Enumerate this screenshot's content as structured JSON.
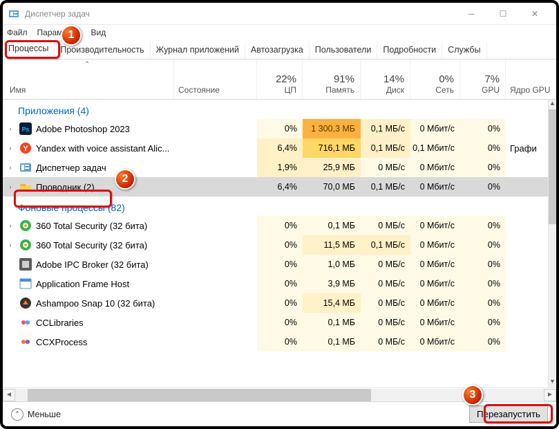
{
  "window": {
    "title": "Диспетчер задач"
  },
  "menu": {
    "file": "Файл",
    "options": "Параметры",
    "view": "Вид"
  },
  "tabs": {
    "processes": "Процессы",
    "performance": "Производительность",
    "app_history": "Журнал приложений",
    "startup": "Автозагрузка",
    "users": "Пользователи",
    "details": "Подробности",
    "services": "Службы"
  },
  "columns": {
    "name": "Имя",
    "state": "Состояние",
    "cpu": {
      "pct": "22%",
      "label": "ЦП"
    },
    "mem": {
      "pct": "91%",
      "label": "Память"
    },
    "disk": {
      "pct": "14%",
      "label": "Диск"
    },
    "net": {
      "pct": "0%",
      "label": "Сеть"
    },
    "gpu": {
      "pct": "7%",
      "label": "GPU"
    },
    "gpucore": {
      "label": "Ядро GPU"
    }
  },
  "groups": {
    "apps": "Приложения (4)",
    "bg": "Фоновые процессы (82)"
  },
  "rows": [
    {
      "group": "apps",
      "expand": true,
      "icon": "ps",
      "name": "Adobe Photoshop 2023",
      "cpu": "0%",
      "mem": "1 300,3 МБ",
      "disk": "0,1 МБ/с",
      "net": "0 Мбит/с",
      "gpu": "0%",
      "gpucore": "",
      "h": {
        "cpu": "h0",
        "mem": "h4",
        "disk": "h1",
        "net": "h0",
        "gpu": "h0"
      }
    },
    {
      "group": "apps",
      "expand": true,
      "icon": "y",
      "name": "Yandex with voice assistant Alic...",
      "cpu": "6,4%",
      "mem": "716,1 МБ",
      "disk": "0,1 МБ/с",
      "net": "0,1 Мбит/с",
      "gpu": "0%",
      "gpucore": "Графи",
      "h": {
        "cpu": "h1",
        "mem": "h3",
        "disk": "h1",
        "net": "h0",
        "gpu": "h0"
      }
    },
    {
      "group": "apps",
      "expand": true,
      "icon": "tm",
      "name": "Диспетчер задач",
      "cpu": "1,9%",
      "mem": "25,9 МБ",
      "disk": "0 МБ/с",
      "net": "0 Мбит/с",
      "gpu": "0%",
      "gpucore": "",
      "h": {
        "cpu": "h1",
        "mem": "h1",
        "disk": "h0",
        "net": "h0",
        "gpu": "h0"
      }
    },
    {
      "group": "apps",
      "expand": true,
      "icon": "folder",
      "name": "Проводник (2)",
      "cpu": "6,4%",
      "mem": "70,0 МБ",
      "disk": "0,1 МБ/с",
      "net": "0 Мбит/с",
      "gpu": "0%",
      "gpucore": "",
      "selected": true,
      "h": {
        "cpu": "hx",
        "mem": "hx",
        "disk": "hx",
        "net": "hx",
        "gpu": "hx"
      }
    },
    {
      "group": "bg",
      "expand": true,
      "icon": "360",
      "name": "360 Total Security (32 бита)",
      "cpu": "0%",
      "mem": "0,1 МБ",
      "disk": "0 МБ/с",
      "net": "0 Мбит/с",
      "gpu": "0%",
      "gpucore": "",
      "h": {
        "cpu": "h0",
        "mem": "h0",
        "disk": "h0",
        "net": "h0",
        "gpu": "h0"
      }
    },
    {
      "group": "bg",
      "expand": true,
      "icon": "360",
      "name": "360 Total Security (32 бита)",
      "cpu": "0%",
      "mem": "11,5 МБ",
      "disk": "0,1 МБ/с",
      "net": "0 Мбит/с",
      "gpu": "0%",
      "gpucore": "",
      "h": {
        "cpu": "h0",
        "mem": "h1",
        "disk": "h1",
        "net": "h0",
        "gpu": "h0"
      }
    },
    {
      "group": "bg",
      "expand": false,
      "icon": "ipc",
      "name": "Adobe IPC Broker (32 бита)",
      "cpu": "0%",
      "mem": "1,0 МБ",
      "disk": "0 МБ/с",
      "net": "0 Мбит/с",
      "gpu": "0%",
      "gpucore": "",
      "h": {
        "cpu": "h0",
        "mem": "h0",
        "disk": "h0",
        "net": "h0",
        "gpu": "h0"
      }
    },
    {
      "group": "bg",
      "expand": false,
      "icon": "afh",
      "name": "Application Frame Host",
      "cpu": "0%",
      "mem": "3,9 МБ",
      "disk": "0 МБ/с",
      "net": "0 Мбит/с",
      "gpu": "0%",
      "gpucore": "",
      "h": {
        "cpu": "h0",
        "mem": "h0",
        "disk": "h0",
        "net": "h0",
        "gpu": "h0"
      }
    },
    {
      "group": "bg",
      "expand": false,
      "icon": "ash",
      "name": "Ashampoo Snap 10 (32 бита)",
      "cpu": "0%",
      "mem": "15,4 МБ",
      "disk": "0 МБ/с",
      "net": "0 Мбит/с",
      "gpu": "0%",
      "gpucore": "",
      "h": {
        "cpu": "h0",
        "mem": "h1",
        "disk": "h0",
        "net": "h0",
        "gpu": "h0"
      }
    },
    {
      "group": "bg",
      "expand": false,
      "icon": "ccl",
      "name": "CCLibraries",
      "cpu": "0%",
      "mem": "0,1 МБ",
      "disk": "0 МБ/с",
      "net": "0 Мбит/с",
      "gpu": "0%",
      "gpucore": "",
      "h": {
        "cpu": "h0",
        "mem": "h0",
        "disk": "h0",
        "net": "h0",
        "gpu": "h0"
      }
    },
    {
      "group": "bg",
      "expand": false,
      "icon": "ccx",
      "name": "CCXProcess",
      "cpu": "0%",
      "mem": "0,1 МБ",
      "disk": "0 МБ/с",
      "net": "0 Мбит/с",
      "gpu": "0%",
      "gpucore": "",
      "h": {
        "cpu": "h0",
        "mem": "h0",
        "disk": "h0",
        "net": "h0",
        "gpu": "h0"
      }
    }
  ],
  "footer": {
    "less": "Меньше",
    "restart": "Перезапустить"
  },
  "annotations": {
    "b1": "1",
    "b2": "2",
    "b3": "3"
  }
}
